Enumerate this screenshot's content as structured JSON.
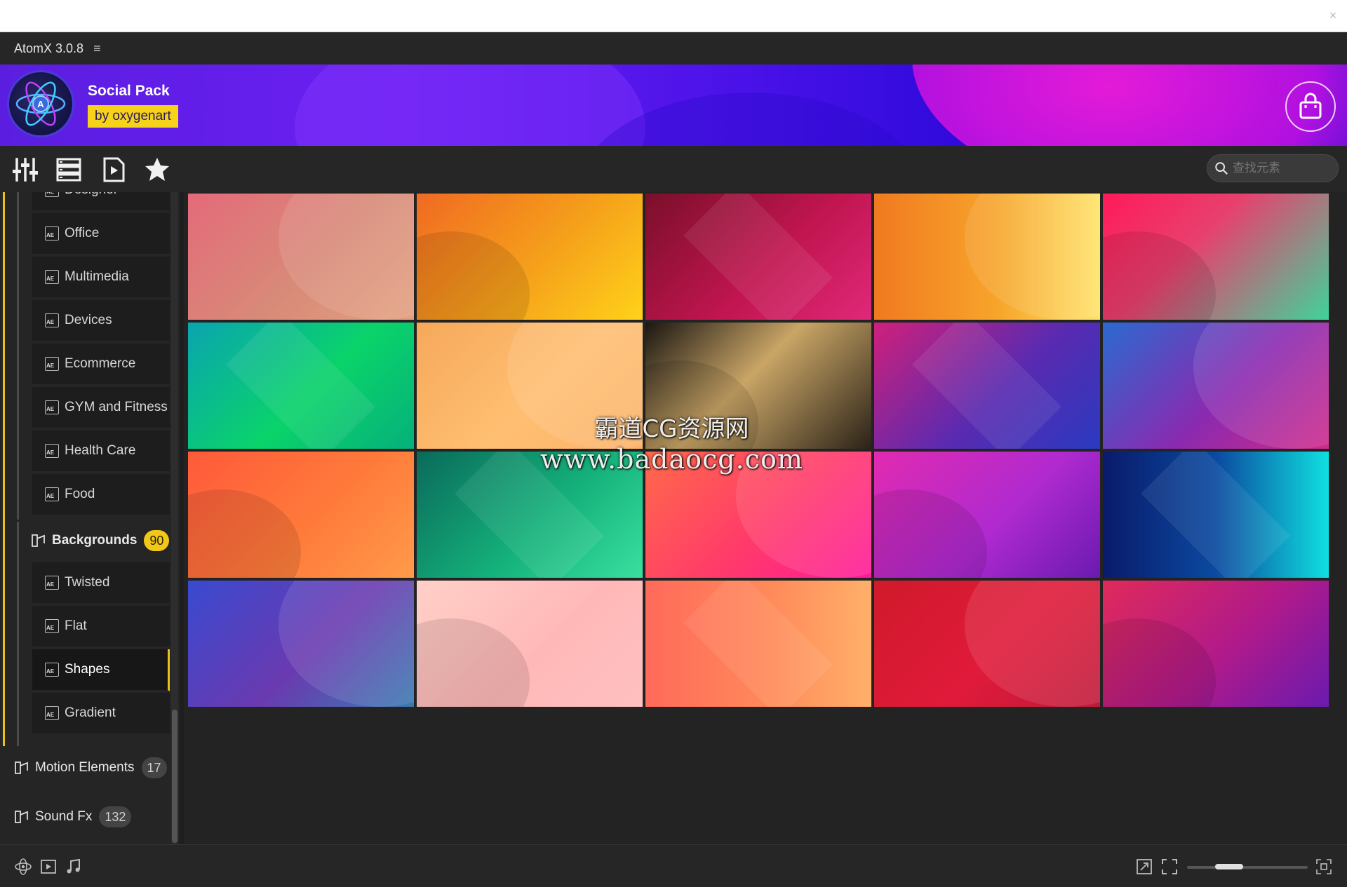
{
  "window": {
    "close_glyph": "×"
  },
  "titlebar": {
    "title": "AtomX 3.0.8",
    "menu_glyph": "≡"
  },
  "banner": {
    "pack_name": "Social Pack",
    "author": "by oxygenart"
  },
  "toolbar": {
    "tools": [
      "sliders-icon",
      "list-icon",
      "play-file-icon",
      "star-icon"
    ],
    "search_placeholder": "查找元素"
  },
  "sidebar": {
    "partial_item": "Designer",
    "items": [
      {
        "label": "Office"
      },
      {
        "label": "Multimedia"
      },
      {
        "label": "Devices"
      },
      {
        "label": "Ecommerce"
      },
      {
        "label": "GYM and Fitness"
      },
      {
        "label": "Health Care"
      },
      {
        "label": "Food"
      }
    ],
    "backgrounds": {
      "label": "Backgrounds",
      "count": "90"
    },
    "bg_items": [
      {
        "label": "Twisted"
      },
      {
        "label": "Flat"
      },
      {
        "label": "Shapes",
        "active": true
      },
      {
        "label": "Gradient"
      }
    ],
    "motion": {
      "label": "Motion Elements",
      "count": "17"
    },
    "sound": {
      "label": "Sound Fx",
      "count": "132"
    },
    "ae_badge": "AE"
  },
  "grid": {
    "tiles": [
      {
        "name": "stripes-coral",
        "bg": "linear-gradient(135deg,#e46a7a,#d88a78 55%,#e3a080)"
      },
      {
        "name": "rings-orange",
        "bg": "linear-gradient(135deg,#f06a22,#f5a11a 55%,#ffd21a)"
      },
      {
        "name": "circle-magenta",
        "bg": "linear-gradient(135deg,#7a0f2a,#c0154f 55%,#e0287a)"
      },
      {
        "name": "chevron-yellow",
        "bg": "linear-gradient(90deg,#f07a20,#f7a52b 55%,#ffe36a)"
      },
      {
        "name": "pills-pink-green",
        "bg": "linear-gradient(135deg,#ff1a5a,#e8406e 40%,#3fd39a)"
      },
      {
        "name": "bubbles-green",
        "bg": "linear-gradient(135deg,#0aa4b0,#0ad36a 55%,#06b07a)"
      },
      {
        "name": "waves-peach",
        "bg": "linear-gradient(135deg,#f6a85a,#ffbf72 55%,#fbb36a)"
      },
      {
        "name": "chevron-gold-black",
        "bg": "linear-gradient(135deg,#1a1612,#c9a566 45%,#2a2218)"
      },
      {
        "name": "streaks-purple",
        "bg": "linear-gradient(135deg,#d0207a,#5a2ab0 55%,#2a3ac0)"
      },
      {
        "name": "arcs-violet",
        "bg": "linear-gradient(135deg,#2a6ad0,#8a2ab0 55%,#d02a8a)"
      },
      {
        "name": "chevron-orange",
        "bg": "linear-gradient(135deg,#ff5a3a,#ff7a3a 55%,#ff9a4a)"
      },
      {
        "name": "rings-teal",
        "bg": "linear-gradient(135deg,#0a6a5a,#14b07a 55%,#3ae0a0)"
      },
      {
        "name": "hex-pink",
        "bg": "linear-gradient(135deg,#ff6a4a,#ff3a6a 55%,#ff1a9a)"
      },
      {
        "name": "circles-purple",
        "bg": "linear-gradient(135deg,#e02ab0,#b02ad0 55%,#6a1ab0)"
      },
      {
        "name": "arcs-cyan",
        "bg": "linear-gradient(90deg,#0a1a6a,#0a4aa0 50%,#10e0e0)"
      },
      {
        "name": "stripes-indigo",
        "bg": "linear-gradient(135deg,#3a4ad0,#6a3ab0 55%,#3a7ab0)"
      },
      {
        "name": "spheres-pink",
        "bg": "linear-gradient(135deg,#ffd0c8,#ffb8b8 55%,#ffc0c0)"
      },
      {
        "name": "waves-salmon",
        "bg": "linear-gradient(90deg,#ff6a5a,#ff8a5a 55%,#ffb06a)"
      },
      {
        "name": "chevron-red",
        "bg": "linear-gradient(135deg,#d01a2a,#e01a3a 55%,#c01a3a)"
      },
      {
        "name": "arcs-magenta",
        "bg": "linear-gradient(135deg,#e02a5a,#b01a8a 55%,#6a1ab0)"
      }
    ]
  },
  "watermark": {
    "line1": "霸道CG资源网",
    "line2": "www.badaocg.com"
  },
  "footer": {
    "left_icons": [
      "atom-icon",
      "video-icon",
      "music-icon"
    ],
    "right_icons": [
      "expand-icon",
      "fullscreen-icon",
      "grid-size-icon"
    ],
    "slider_value": 0.3
  },
  "colors": {
    "accent": "#f1c81a",
    "panel": "#252525",
    "background": "#232323"
  }
}
